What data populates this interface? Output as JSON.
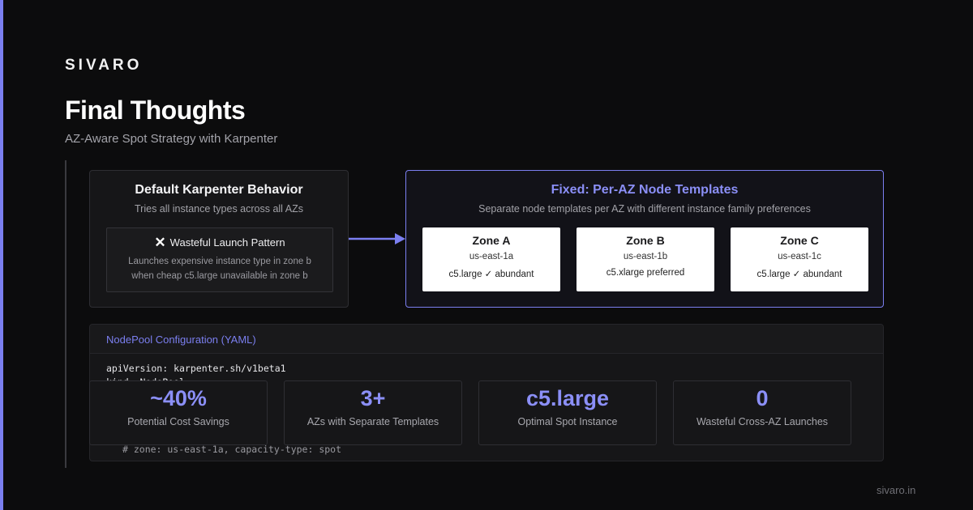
{
  "brand": {
    "logo": "SIVARO",
    "footer_url": "sivaro.in",
    "accent": "#7b7ff0"
  },
  "header": {
    "title": "Final Thoughts",
    "subtitle": "AZ-Aware Spot Strategy with Karpenter"
  },
  "default_card": {
    "title": "Default Karpenter Behavior",
    "subtitle": "Tries all instance types across all AZs",
    "warning": {
      "icon": "x-icon",
      "title": "Wasteful Launch Pattern",
      "line1": "Launches expensive instance type in zone b",
      "line2": "when cheap c5.large unavailable in zone b"
    }
  },
  "fixed_card": {
    "title": "Fixed: Per-AZ Node Templates",
    "subtitle": "Separate node templates per AZ with different instance family preferences",
    "zones": [
      {
        "name": "Zone A",
        "id": "us-east-1a",
        "info": "c5.large ✓ abundant"
      },
      {
        "name": "Zone B",
        "id": "us-east-1b",
        "info": "c5.xlarge preferred"
      },
      {
        "name": "Zone C",
        "id": "us-east-1c",
        "info": "c5.large ✓ abundant"
      }
    ]
  },
  "yaml": {
    "title": "NodePool Configuration (YAML)",
    "line1": "apiVersion: karpenter.sh/v1beta1",
    "line2": "kind: NodePool",
    "comment": "# zone: us-east-1a, capacity-type: spot"
  },
  "stats": [
    {
      "value": "~40%",
      "label": "Potential Cost Savings"
    },
    {
      "value": "3+",
      "label": "AZs with Separate Templates"
    },
    {
      "value": "c5.large",
      "label": "Optimal Spot Instance"
    },
    {
      "value": "0",
      "label": "Wasteful Cross-AZ Launches"
    }
  ]
}
